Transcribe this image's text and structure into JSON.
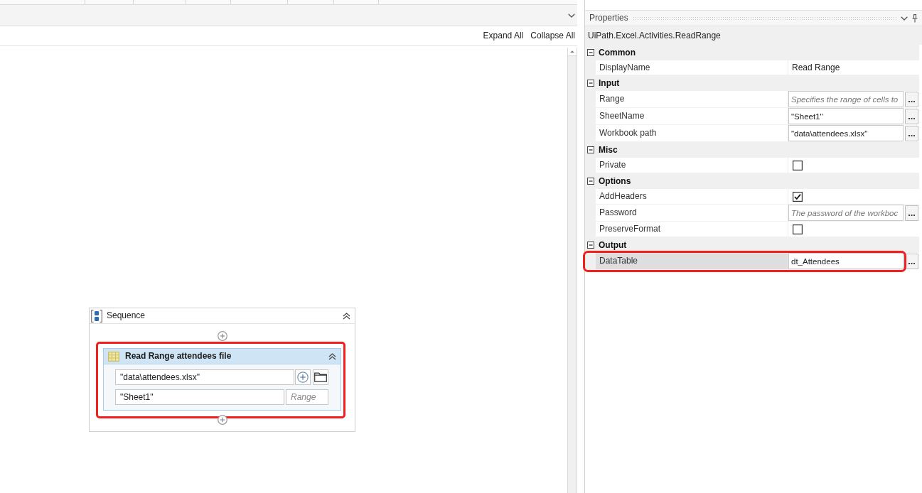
{
  "designer": {
    "toolbar": {
      "expand_all": "Expand All",
      "collapse_all": "Collapse All"
    },
    "sequence": {
      "title": "Sequence",
      "activity": {
        "title": "Read Range attendees file",
        "highlighted": true,
        "workbook_path": {
          "value": "\"data\\attendees.xlsx\""
        },
        "sheet_name": {
          "value": "\"Sheet1\""
        },
        "range": {
          "placeholder": "Range"
        }
      }
    }
  },
  "properties": {
    "title": "Properties",
    "type_name": "UiPath.Excel.Activities.ReadRange",
    "categories": [
      {
        "name": "Common",
        "expanded": true,
        "rows": [
          {
            "name": "DisplayName",
            "kind": "text",
            "value": "Read Range",
            "selected": false,
            "highlighted": false
          }
        ]
      },
      {
        "name": "Input",
        "expanded": true,
        "rows": [
          {
            "name": "Range",
            "kind": "field",
            "placeholder": "Specifies the range of cells to",
            "selected": false,
            "highlighted": false
          },
          {
            "name": "SheetName",
            "kind": "field",
            "value": "\"Sheet1\"",
            "selected": false,
            "highlighted": false
          },
          {
            "name": "Workbook path",
            "kind": "field",
            "value": "\"data\\attendees.xlsx\"",
            "selected": false,
            "highlighted": false
          }
        ]
      },
      {
        "name": "Misc",
        "expanded": true,
        "rows": [
          {
            "name": "Private",
            "kind": "checkbox",
            "checked": false,
            "selected": false,
            "highlighted": false
          }
        ]
      },
      {
        "name": "Options",
        "expanded": true,
        "rows": [
          {
            "name": "AddHeaders",
            "kind": "checkbox",
            "checked": true,
            "selected": false,
            "highlighted": false
          },
          {
            "name": "Password",
            "kind": "field",
            "placeholder": "The password of the workboc",
            "selected": false,
            "highlighted": false
          },
          {
            "name": "PreserveFormat",
            "kind": "checkbox",
            "checked": false,
            "selected": false,
            "highlighted": false
          }
        ]
      },
      {
        "name": "Output",
        "expanded": true,
        "rows": [
          {
            "name": "DataTable",
            "kind": "field",
            "value": "dt_Attendees",
            "selected": true,
            "highlighted": true
          }
        ]
      }
    ]
  }
}
